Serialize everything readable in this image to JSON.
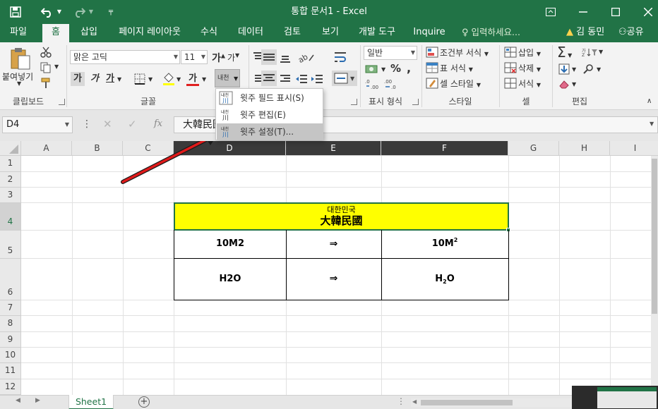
{
  "window": {
    "title": "통합 문서1 - Excel"
  },
  "qat": {
    "save": "save-icon",
    "undo": "undo-icon",
    "redo": "redo-icon"
  },
  "tabs": [
    "파일",
    "홈",
    "삽입",
    "페이지 레이아웃",
    "수식",
    "데이터",
    "검토",
    "보기",
    "개발 도구",
    "Inquire"
  ],
  "active_tab": "홈",
  "tell_me": "입력하세요...",
  "user": "김 동민",
  "share": "공유",
  "ribbon": {
    "clipboard": {
      "paste": "붙여넣기",
      "label": "클립보드"
    },
    "font": {
      "name": "맑은 고딕",
      "size": "11",
      "bold": "가",
      "italic": "가",
      "underline": "가",
      "increase": "가",
      "decrease": "가",
      "phonetic": "내천",
      "font_color_glyph": "가",
      "label": "글꼴"
    },
    "number": {
      "format": "일반",
      "percent": "%",
      "label": "표시 형식"
    },
    "styles": {
      "conditional": "조건부 서식",
      "table": "표 서식",
      "cell": "셀 스타일",
      "label": "스타일"
    },
    "cells": {
      "insert": "삽입",
      "delete": "삭제",
      "format": "서식",
      "label": "셀"
    },
    "editing": {
      "label": "편집"
    },
    "accent": "#217346"
  },
  "phonetic_menu": {
    "items": [
      {
        "label": "윗주 필드 표시(S)",
        "highlighted": false
      },
      {
        "label": "윗주 편집(E)",
        "highlighted": false
      },
      {
        "label": "윗주 설정(T)...",
        "highlighted": true
      }
    ]
  },
  "formula_bar": {
    "name_box": "D4",
    "content": "大韓民國"
  },
  "grid": {
    "columns": [
      "A",
      "B",
      "C",
      "D",
      "E",
      "F",
      "G",
      "H",
      "I"
    ],
    "rows": [
      "1",
      "2",
      "3",
      "4",
      "5",
      "6",
      "7",
      "8",
      "9",
      "10",
      "11",
      "12"
    ],
    "selected_col": "D",
    "selected_row": "4",
    "cells": {
      "d4_ruby": "대한민국",
      "d4_main": "大韓民國",
      "d5": "10M2",
      "e5": "⇒",
      "f5_base": "10M",
      "f5_sup": "2",
      "d6": "H2O",
      "e6": "⇒",
      "f6_a": "H",
      "f6_sub": "2",
      "f6_b": "O"
    },
    "highlight_color": "#ffff00"
  },
  "sheet_tabs": [
    "Sheet1"
  ]
}
